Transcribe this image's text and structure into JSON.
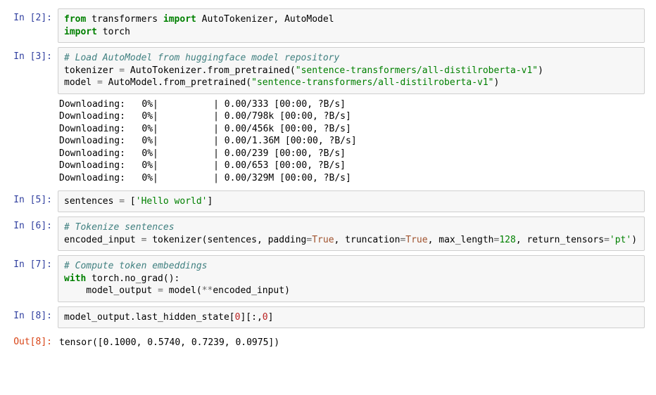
{
  "cells": [
    {
      "prompt": "In [2]:"
    },
    {
      "prompt": "In [3]:"
    },
    {
      "prompt": "In [5]:"
    },
    {
      "prompt": "In [6]:"
    },
    {
      "prompt": "In [7]:"
    },
    {
      "prompt": "In [8]:"
    },
    {
      "prompt": "Out[8]:"
    }
  ],
  "cell2": {
    "l1_from": "from",
    "l1_mod": " transformers ",
    "l1_import": "import",
    "l1_names": " AutoTokenizer, AutoModel",
    "l2_import": "import",
    "l2_mod": " torch"
  },
  "cell3": {
    "comment": "# Load AutoModel from huggingface model repository",
    "l2a": "tokenizer ",
    "l2op": "=",
    "l2b": " AutoTokenizer.from_pretrained(",
    "l2str": "\"sentence-transformers/all-distilroberta-v1\"",
    "l2c": ")",
    "l3a": "model ",
    "l3op": "=",
    "l3b": " AutoModel.from_pretrained(",
    "l3str": "\"sentence-transformers/all-distilroberta-v1\"",
    "l3c": ")",
    "downloads": [
      "Downloading:   0%|          | 0.00/333 [00:00, ?B/s]",
      "Downloading:   0%|          | 0.00/798k [00:00, ?B/s]",
      "Downloading:   0%|          | 0.00/456k [00:00, ?B/s]",
      "Downloading:   0%|          | 0.00/1.36M [00:00, ?B/s]",
      "Downloading:   0%|          | 0.00/239 [00:00, ?B/s]",
      "Downloading:   0%|          | 0.00/653 [00:00, ?B/s]",
      "Downloading:   0%|          | 0.00/329M [00:00, ?B/s]"
    ]
  },
  "cell5": {
    "a": "sentences ",
    "op": "=",
    "b": " [",
    "str": "'Hello world'",
    "c": "]"
  },
  "cell6": {
    "comment": "# Tokenize sentences",
    "a": "encoded_input ",
    "op": "=",
    "b": " tokenizer(sentences, padding",
    "op2": "=",
    "true1": "True",
    "c": ", truncation",
    "op3": "=",
    "true2": "True",
    "d": ", max_length",
    "op4": "=",
    "num": "128",
    "e": ", return_tensors",
    "op5": "=",
    "str": "'pt'",
    "f": ")"
  },
  "cell7": {
    "comment": "# Compute token embeddings",
    "l2_with": "with",
    "l2a": " torch.no_grad():",
    "l3a": "    model_output ",
    "l3op": "=",
    "l3b": " model(",
    "l3op2": "**",
    "l3c": "encoded_input)"
  },
  "cell8": {
    "a": "model_output.last_hidden_state[",
    "n0": "0",
    "b": "][:,",
    "n1": "0",
    "c": "]"
  },
  "out8": {
    "text": "tensor([0.1000, 0.5740, 0.7239, 0.0975])"
  }
}
